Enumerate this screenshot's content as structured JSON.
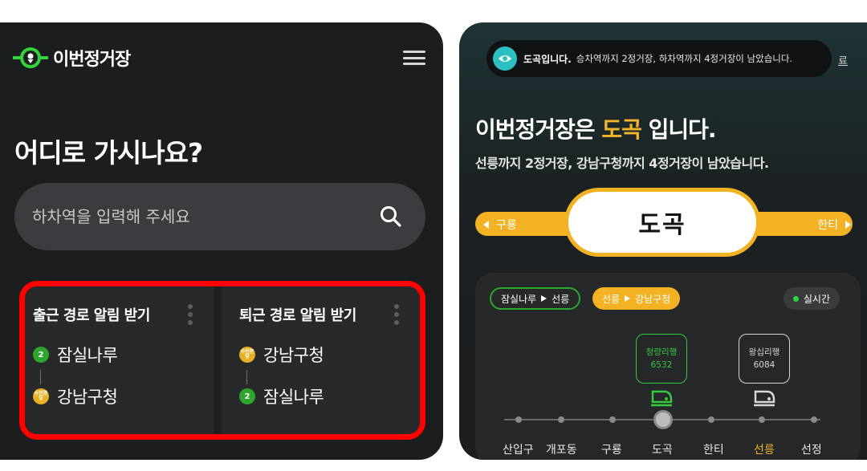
{
  "left": {
    "logo_text": "이번정거장",
    "title": "어디로 가시나요?",
    "search_placeholder": "하차역을 입력해 주세요",
    "cards": [
      {
        "title": "출근 경로 알림 받기",
        "stops": [
          {
            "badge": "2",
            "name": "잠실나루"
          },
          {
            "badge": "수인분당",
            "name": "강남구청"
          }
        ]
      },
      {
        "title": "퇴근 경로 알림 받기",
        "stops": [
          {
            "badge": "수인분당",
            "name": "강남구청"
          },
          {
            "badge": "2",
            "name": "잠실나루"
          }
        ]
      }
    ]
  },
  "right": {
    "toast_strong": "도곡입니다.",
    "toast_text": "승차역까지 2정거장, 하차역까지 4정거장이 남았습니다.",
    "toast_end": "료",
    "title_prefix": "이번정거장은",
    "title_station": "도곡",
    "title_suffix": "입니다.",
    "subtitle": "선릉까지 2정거장, 강남구청까지 4정거장이 남았습니다.",
    "prev_station": "구룡",
    "current_station": "도곡",
    "next_station": "한티",
    "chips": [
      {
        "from": "잠실나루",
        "to": "선릉"
      },
      {
        "from": "선릉",
        "to": "강남구청"
      }
    ],
    "realtime_label": "실시간",
    "trains": [
      {
        "dest": "청량리행",
        "number": "6532"
      },
      {
        "dest": "왕십리행",
        "number": "6084"
      }
    ],
    "track_stations": [
      "산입구",
      "개포동",
      "구룡",
      "도곡",
      "한티",
      "선릉",
      "선정"
    ],
    "highlight_station": "선릉"
  },
  "colors": {
    "line2_green": "#2ea62e",
    "suin_bundang_yellow": "#f2b223",
    "alarm_outline": "#ff0000",
    "toast_accent": "#2cc0c3"
  },
  "icons": [
    "location-pin-icon",
    "menu-icon",
    "search-icon",
    "more-vertical-icon",
    "play-arrow-icon",
    "train-icon"
  ]
}
